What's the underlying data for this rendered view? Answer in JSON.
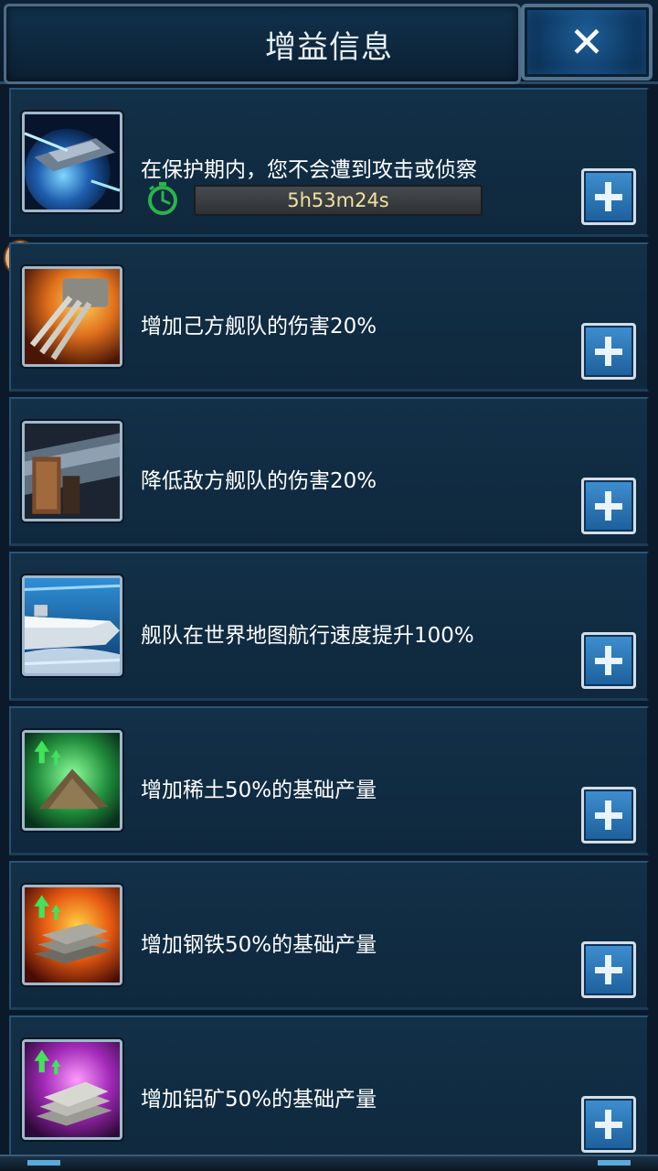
{
  "header": {
    "title": "增益信息",
    "close_label": "✕"
  },
  "buffs": [
    {
      "description": "在保护期内，您不会遭到攻击或侦察",
      "icon": "shield-fleet-icon",
      "timer": "5h53m24s"
    },
    {
      "description": "增加己方舰队的伤害20%",
      "icon": "turret-cannon-icon"
    },
    {
      "description": "降低敌方舰队的伤害20%",
      "icon": "armor-plate-icon"
    },
    {
      "description": "舰队在世界地图航行速度提升100%",
      "icon": "fast-ship-icon"
    },
    {
      "description": "增加稀土50%的基础产量",
      "icon": "rare-earth-icon"
    },
    {
      "description": "增加钢铁50%的基础产量",
      "icon": "steel-ingot-icon"
    },
    {
      "description": "增加铝矿50%的基础产量",
      "icon": "aluminum-ore-icon"
    }
  ],
  "colors": {
    "accent_blue": "#1c5f9b",
    "panel": "#123048",
    "timer_text": "#f0e2a0"
  }
}
